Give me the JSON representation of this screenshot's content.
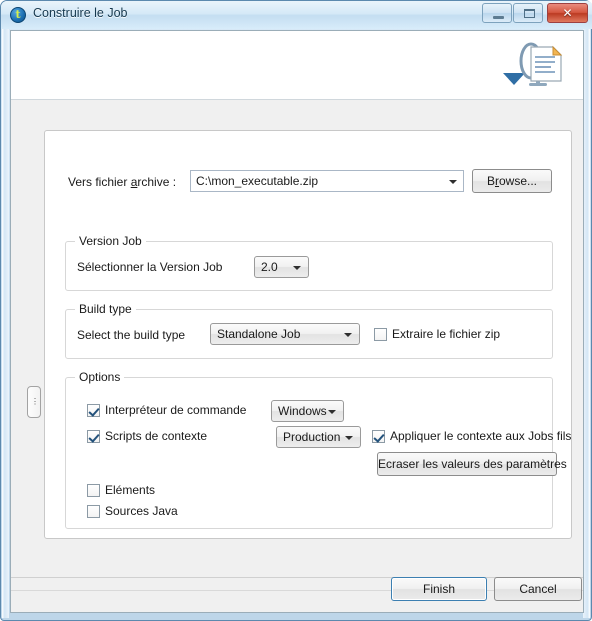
{
  "window": {
    "title": "Construire le Job",
    "icon": "talend-circle-icon",
    "controls": {
      "minimize": "minimize-icon",
      "maximize": "maximize-icon",
      "close": "✕"
    }
  },
  "banner": {
    "icon": "document-wizard-icon"
  },
  "sash": {
    "handle": "⋮"
  },
  "archive": {
    "label_before": "Vers fichier ",
    "label_mnemonic": "a",
    "label_after": "rchive :",
    "value": "C:\\mon_executable.zip",
    "placeholder": "",
    "browse_before": "B",
    "browse_mnemonic": "r",
    "browse_after": "owse..."
  },
  "version_group": {
    "title": "Version Job",
    "label": "Sélectionner la Version Job",
    "value": "2.0"
  },
  "build_group": {
    "title": "Build type",
    "label": "Select the build type",
    "value": "Standalone Job",
    "extract_checkbox": {
      "label": "Extraire le fichier zip",
      "checked": false
    }
  },
  "options_group": {
    "title": "Options",
    "shell_checkbox": {
      "label": "Interpréteur de commande",
      "checked": true
    },
    "shell_value": "Windows",
    "context_checkbox": {
      "label": "Scripts de contexte",
      "checked": true
    },
    "context_value": "Production",
    "apply_children_checkbox": {
      "label": "Appliquer le contexte aux Jobs fils",
      "checked": true
    },
    "overwrite_button": "Ecraser les valeurs des paramètres",
    "items_checkbox": {
      "label": "Eléments",
      "checked": false
    },
    "java_sources_checkbox": {
      "label": "Sources Java",
      "checked": false
    }
  },
  "footer": {
    "finish": "Finish",
    "cancel": "Cancel"
  },
  "colors": {
    "accent": "#3c7fb1",
    "close_button": "#c0392b",
    "panel_bg": "#ffffff",
    "dialog_bg": "#f0f0f0"
  }
}
